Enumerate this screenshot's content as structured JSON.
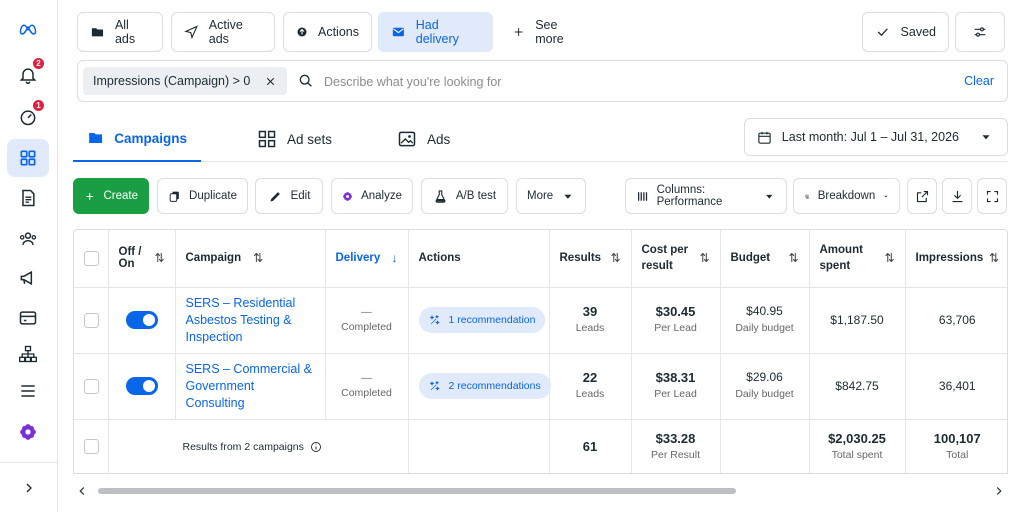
{
  "rail": {
    "notifications_badge": "2",
    "insights_badge": "1"
  },
  "filters": {
    "all_ads": "All ads",
    "active_ads": "Active ads",
    "actions": "Actions",
    "had_delivery": "Had delivery",
    "see_more": "See more",
    "saved": "Saved"
  },
  "search": {
    "applied_filter": "Impressions (Campaign) > 0",
    "placeholder": "Describe what you're looking for",
    "clear": "Clear"
  },
  "tabs": {
    "campaigns": "Campaigns",
    "ad_sets": "Ad sets",
    "ads": "Ads",
    "date_range": "Last month: Jul 1 – Jul 31, 2026"
  },
  "toolbar": {
    "create": "Create",
    "duplicate": "Duplicate",
    "edit": "Edit",
    "analyze": "Analyze",
    "ab_test": "A/B test",
    "more": "More",
    "columns": "Columns: Performance",
    "breakdown": "Breakdown"
  },
  "table": {
    "headers": {
      "off_on": "Off / On",
      "campaign": "Campaign",
      "delivery": "Delivery",
      "actions": "Actions",
      "results": "Results",
      "cost_per_result": "Cost per result",
      "budget": "Budget",
      "amount_spent": "Amount spent",
      "impressions": "Impressions"
    },
    "rows": [
      {
        "campaign": "SERS – Residential Asbestos Testing & Inspection",
        "delivery_dash": "—",
        "delivery": "Completed",
        "recommendation": "1 recommendation",
        "results": "39",
        "results_label": "Leads",
        "cost": "$30.45",
        "cost_label": "Per Lead",
        "budget": "$40.95",
        "budget_label": "Daily budget",
        "spent": "$1,187.50",
        "impressions": "63,706"
      },
      {
        "campaign": "SERS – Commercial & Government Consulting",
        "delivery_dash": "—",
        "delivery": "Completed",
        "recommendation": "2 recommendations",
        "results": "22",
        "results_label": "Leads",
        "cost": "$38.31",
        "cost_label": "Per Lead",
        "budget": "$29.06",
        "budget_label": "Daily budget",
        "spent": "$842.75",
        "impressions": "36,401"
      }
    ],
    "totals": {
      "label": "Results from 2 campaigns",
      "results": "61",
      "cost": "$33.28",
      "cost_label": "Per Result",
      "spent": "$2,030.25",
      "spent_label": "Total spent",
      "impressions": "100,107",
      "impressions_label": "Total"
    }
  },
  "colors": {
    "accent": "#0a66e8",
    "create_green": "#1a9e44",
    "badge_red": "#e41e3f"
  }
}
